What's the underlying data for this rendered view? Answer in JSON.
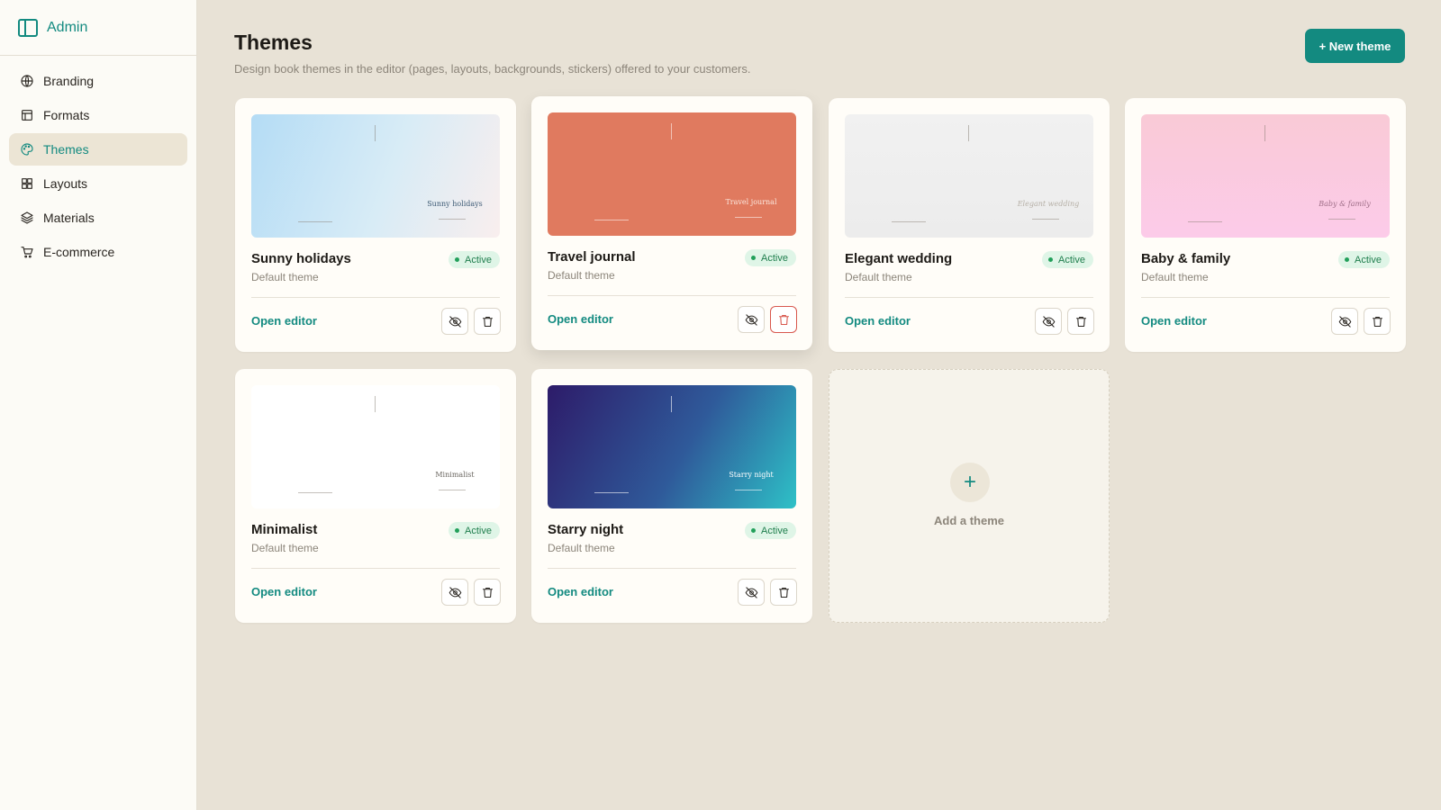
{
  "app": {
    "brand": "Admin"
  },
  "sidebar": {
    "items": [
      {
        "label": "Branding",
        "icon": "globe-icon",
        "active": false
      },
      {
        "label": "Formats",
        "icon": "layout-icon",
        "active": false
      },
      {
        "label": "Themes",
        "icon": "palette-icon",
        "active": true
      },
      {
        "label": "Layouts",
        "icon": "grid-icon",
        "active": false
      },
      {
        "label": "Materials",
        "icon": "layers-icon",
        "active": false
      },
      {
        "label": "E-commerce",
        "icon": "cart-icon",
        "active": false
      }
    ]
  },
  "header": {
    "title": "Themes",
    "subtitle": "Design book themes in the editor (pages, layouts, backgrounds, stickers) offered to your customers.",
    "new_button": "+ New theme"
  },
  "themes": [
    {
      "name": "Sunny holidays",
      "type": "Default theme",
      "status": "Active",
      "thumb_title": "Sunny holidays",
      "open_label": "Open editor",
      "bg": "linear-gradient(110deg,#b4dcf5 0%,#d8ecf6 55%,#f9eeee 100%)",
      "title_color": "#3d5a74"
    },
    {
      "name": "Travel journal",
      "type": "Default theme",
      "status": "Active",
      "thumb_title": "Travel journal",
      "open_label": "Open editor",
      "bg": "#e07a5f",
      "title_color": "#fbe7de"
    },
    {
      "name": "Elegant wedding",
      "type": "Default theme",
      "status": "Active",
      "thumb_title": "Elegant wedding",
      "open_label": "Open editor",
      "bg": "linear-gradient(180deg,#f1f1f1 0%,#ececec 100%)",
      "title_color": "#b6b0a7"
    },
    {
      "name": "Baby & family",
      "type": "Default theme",
      "status": "Active",
      "thumb_title": "Baby & family",
      "open_label": "Open editor",
      "bg": "linear-gradient(180deg,#f9cad6 0%,#fccbe9 100%)",
      "title_color": "#9f6f88"
    },
    {
      "name": "Minimalist",
      "type": "Default theme",
      "status": "Active",
      "thumb_title": "Minimalist",
      "open_label": "Open editor",
      "bg": "#ffffff",
      "title_color": "#6a6660"
    },
    {
      "name": "Starry night",
      "type": "Default theme",
      "status": "Active",
      "thumb_title": "Starry night",
      "open_label": "Open editor",
      "bg": "linear-gradient(120deg,#2d1b69 0%,#2f5a9a 55%,#2ec1c7 100%)",
      "title_color": "#ffffff"
    }
  ],
  "add_card": {
    "label": "Add a theme",
    "plus": "+"
  },
  "colors": {
    "accent": "#138a80",
    "background": "#e8e2d6",
    "sidebar": "#fcfbf6",
    "active_badge": "#dff5e7",
    "danger": "#d8574d"
  }
}
